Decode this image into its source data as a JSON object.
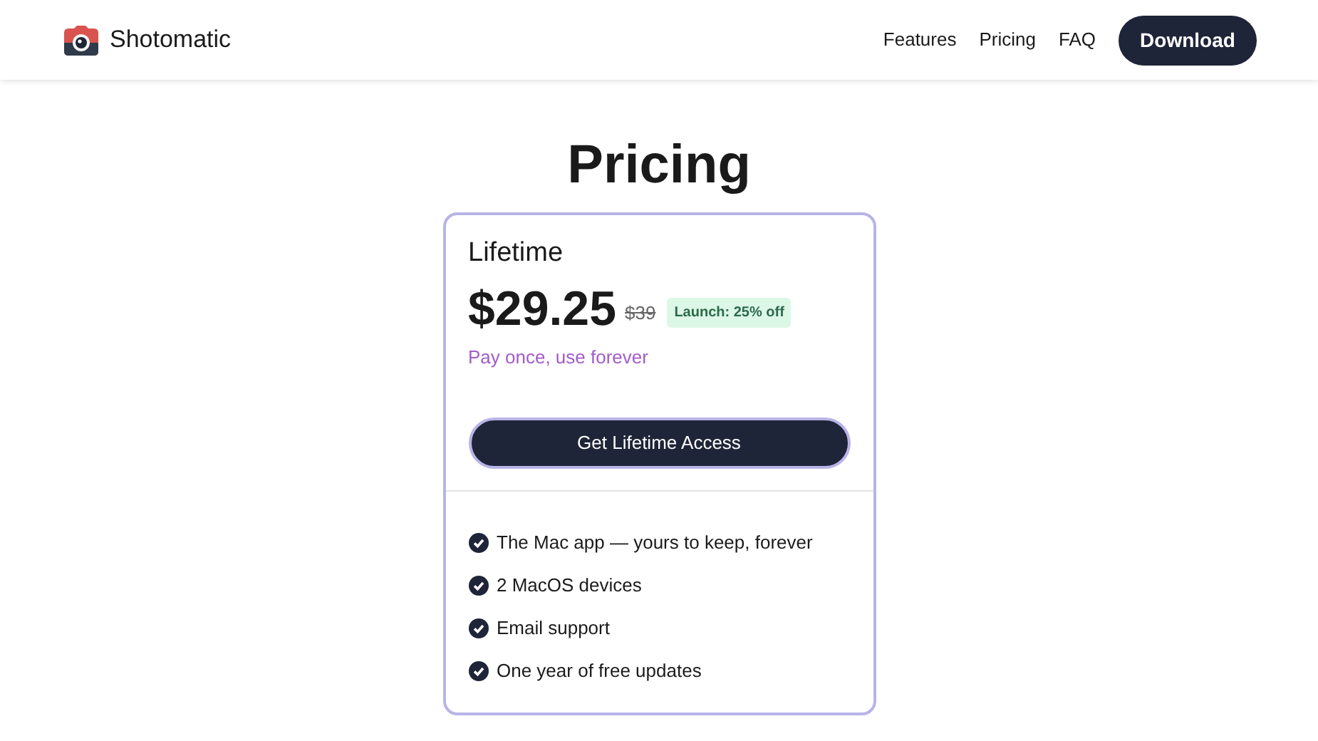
{
  "header": {
    "brand": "Shotomatic",
    "nav": [
      {
        "label": "Features"
      },
      {
        "label": "Pricing"
      },
      {
        "label": "FAQ"
      }
    ],
    "cta": "Download"
  },
  "page_title": "Pricing",
  "plan": {
    "name": "Lifetime",
    "price": "$29.25",
    "old_price": "$39",
    "badge": "Launch: 25% off",
    "tagline": "Pay once, use forever",
    "button": "Get Lifetime Access",
    "features": [
      "The Mac app — yours to keep, forever",
      "2 MacOS devices",
      "Email support",
      "One year of free updates"
    ]
  }
}
